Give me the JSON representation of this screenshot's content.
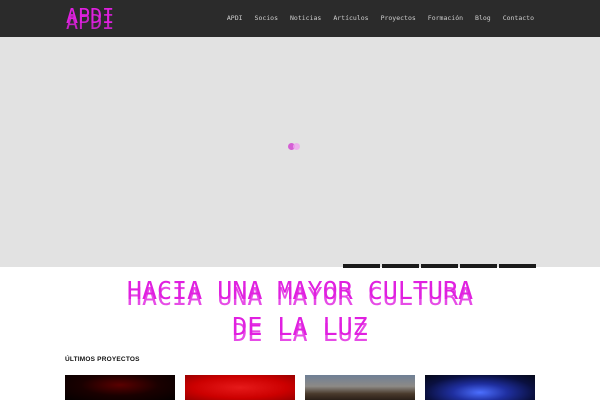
{
  "header": {
    "logo_text": "APDI",
    "nav": [
      "APDI",
      "Socios",
      "Noticias",
      "Artículos",
      "Proyectos",
      "Formación",
      "Blog",
      "Contacto"
    ]
  },
  "slider": {
    "thumbnail_count": 5
  },
  "headline": {
    "line1": "HACIA UNA MAYOR CULTURA",
    "line2": "DE LA LUZ"
  },
  "projects_section": {
    "title": "ÚLTIMOS PROYECTOS",
    "items": [
      "project-1",
      "project-2",
      "project-3",
      "project-4"
    ]
  },
  "colors": {
    "accent": "#e020e0",
    "header_bg": "#2b2b2b",
    "slider_bg": "#e2e2e2"
  }
}
